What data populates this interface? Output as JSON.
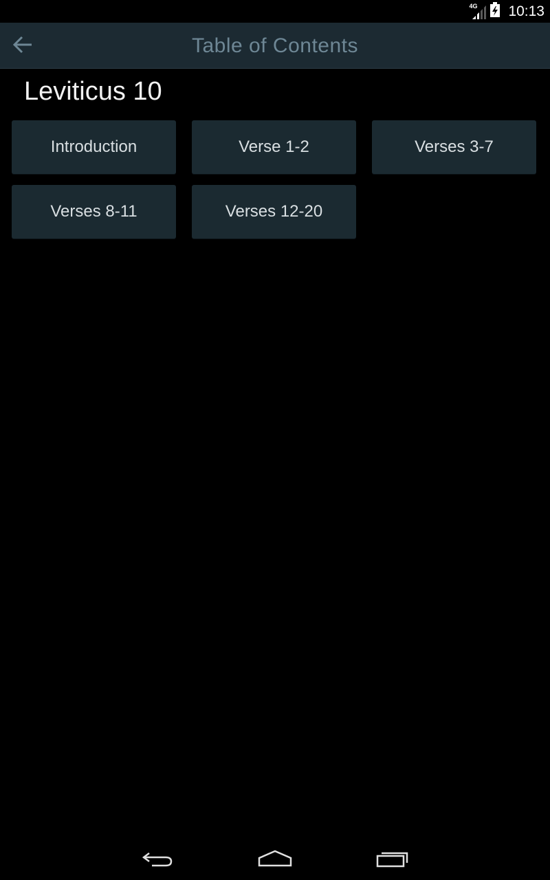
{
  "status_bar": {
    "time": "10:13",
    "network_type": "4G",
    "icons": [
      "signal-icon",
      "battery-icon"
    ]
  },
  "action_bar": {
    "title": "Table of Contents",
    "back_icon": "arrow-left-icon"
  },
  "content": {
    "chapter_title": "Leviticus 10",
    "sections": [
      {
        "label": "Introduction"
      },
      {
        "label": "Verse 1-2"
      },
      {
        "label": "Verses 3-7"
      },
      {
        "label": "Verses 8-11"
      },
      {
        "label": "Verses 12-20"
      }
    ]
  },
  "nav_bar": {
    "icons": [
      "back-icon",
      "home-icon",
      "recent-apps-icon"
    ]
  },
  "colors": {
    "background": "#000000",
    "action_bar": "#1c2a32",
    "button": "#1b2a31",
    "title_text": "#6e8795",
    "button_text": "#d9dfe2"
  }
}
